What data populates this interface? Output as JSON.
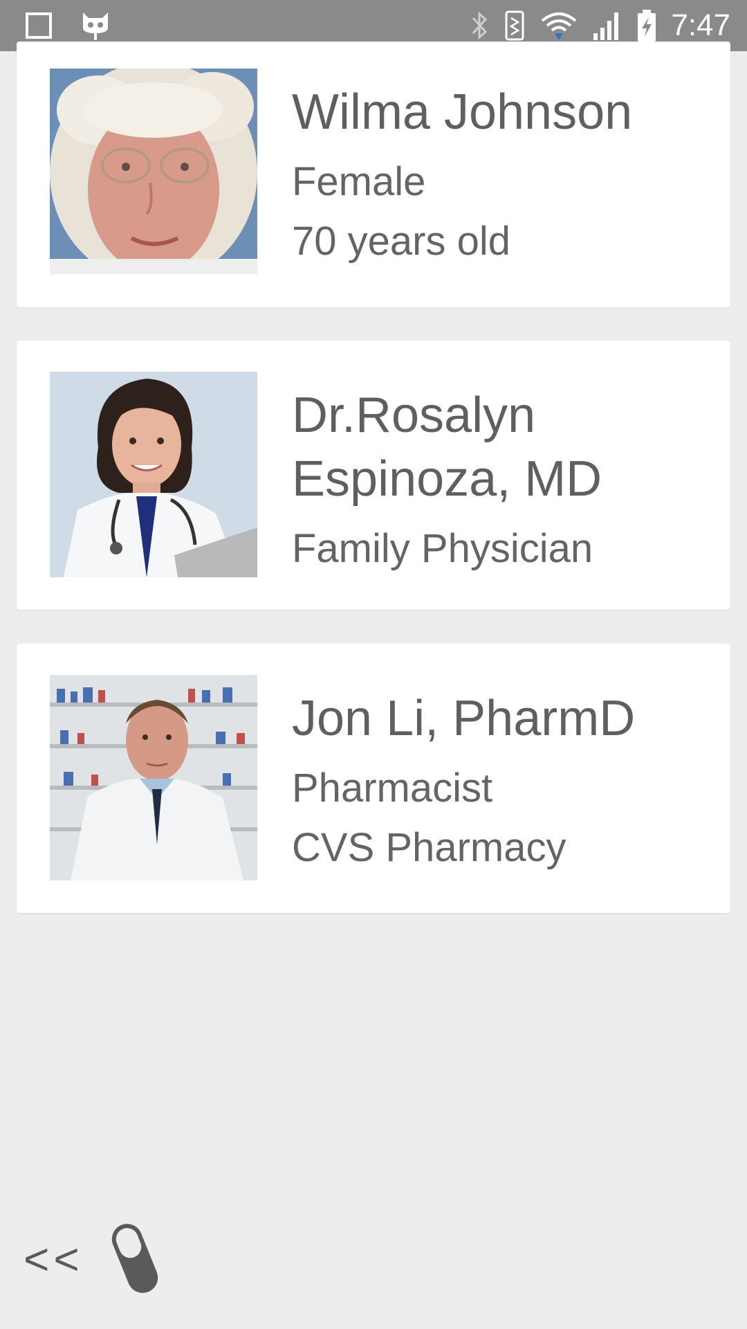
{
  "status_bar": {
    "time": "7:47",
    "icons": [
      "square-notification-icon",
      "cyanogen-icon",
      "bluetooth-icon",
      "vibrate-icon",
      "wifi-icon",
      "signal-icon",
      "battery-charging-icon"
    ]
  },
  "contacts": [
    {
      "name_lines": [
        "Wilma Johnson"
      ],
      "details": [
        "Female",
        "70 years old"
      ],
      "photo": "patient-photo"
    },
    {
      "name_lines": [
        "Dr.Rosalyn",
        "Espinoza, MD"
      ],
      "details": [
        "Family Physician"
      ],
      "photo": "doctor-photo"
    },
    {
      "name_lines": [
        "Jon Li, PharmD"
      ],
      "details": [
        "Pharmacist",
        "CVS Pharmacy"
      ],
      "photo": "pharmacist-photo"
    }
  ],
  "bottom_nav": {
    "back_label": "<<",
    "pill_icon": "pill-icon"
  },
  "colors": {
    "background": "#ededed",
    "card": "#ffffff",
    "text": "#666666",
    "status_bar": "#8a8a8a"
  }
}
